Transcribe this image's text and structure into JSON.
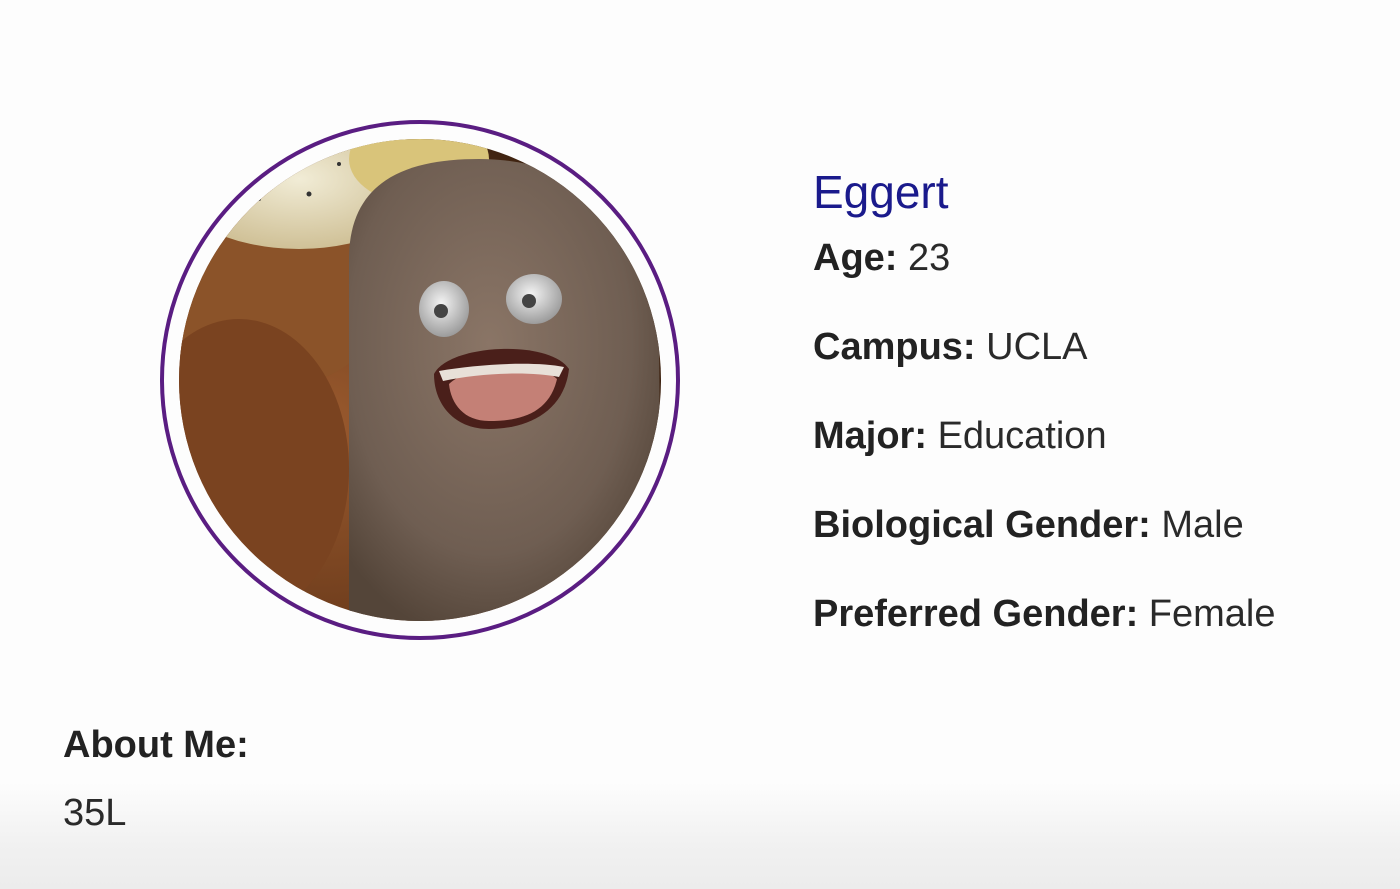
{
  "profile": {
    "name": "Eggert",
    "avatar_alt": "profile-photo",
    "fields": [
      {
        "label": "Age:",
        "value": "23"
      },
      {
        "label": "Campus:",
        "value": "UCLA"
      },
      {
        "label": "Major:",
        "value": "Education"
      },
      {
        "label": "Biological Gender:",
        "value": "Male"
      },
      {
        "label": "Preferred Gender:",
        "value": "Female"
      }
    ]
  },
  "about": {
    "title": "About Me:",
    "text": "35L"
  },
  "colors": {
    "name": "#1a1a8c",
    "avatar_ring": "#5a1d82"
  }
}
